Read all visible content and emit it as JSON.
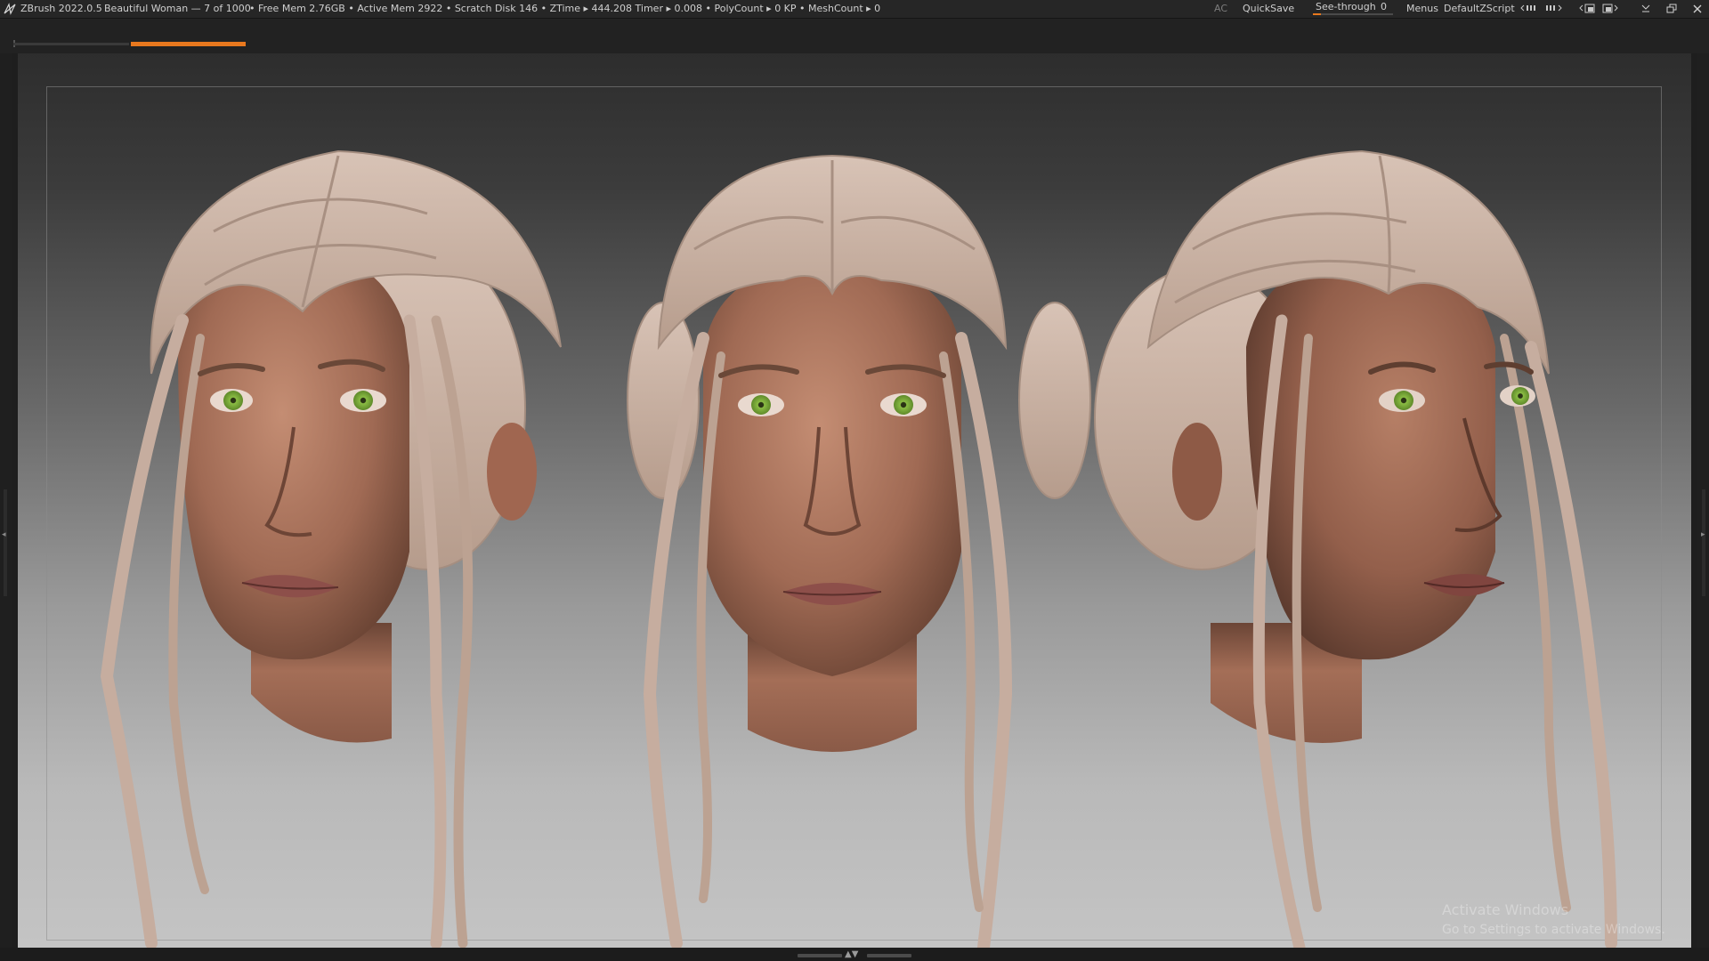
{
  "topbar": {
    "app_name": "ZBrush 2022.0.5",
    "doc_title": "Beautiful Woman — 7 of 1000",
    "stats": [
      "• Free Mem 2.76GB",
      "• Active Mem 2922",
      "• Scratch Disk 146",
      "• ZTime ▸ 444.208",
      "Timer ▸ 0.008",
      "• PolyCount ▸ 0 KP",
      "• MeshCount ▸ 0"
    ],
    "ac_label": "AC",
    "quicksave_label": "QuickSave",
    "seethrough_label": "See-through",
    "seethrough_value": "0",
    "seethrough_fraction": 0.1,
    "menus_label": "Menus",
    "script_label": "DefaultZScript",
    "icons": [
      "layout-icon",
      "layout-icon",
      "interface-icon",
      "interface-icon",
      "minimize-icon",
      "restore-icon",
      "close-icon"
    ],
    "accent_color": "#e8781e"
  },
  "canvas": {
    "subjects": [
      "head-three-quarter-left",
      "head-front",
      "head-three-quarter-right"
    ],
    "skin_color": "#a8705a",
    "hair_color": "#c4ad9f",
    "iris_color": "#7fae3a"
  },
  "watermark": {
    "line1": "Activate Windows",
    "line2": "Go to Settings to activate Windows."
  },
  "bottombar": {
    "arrows": "▲▼"
  }
}
